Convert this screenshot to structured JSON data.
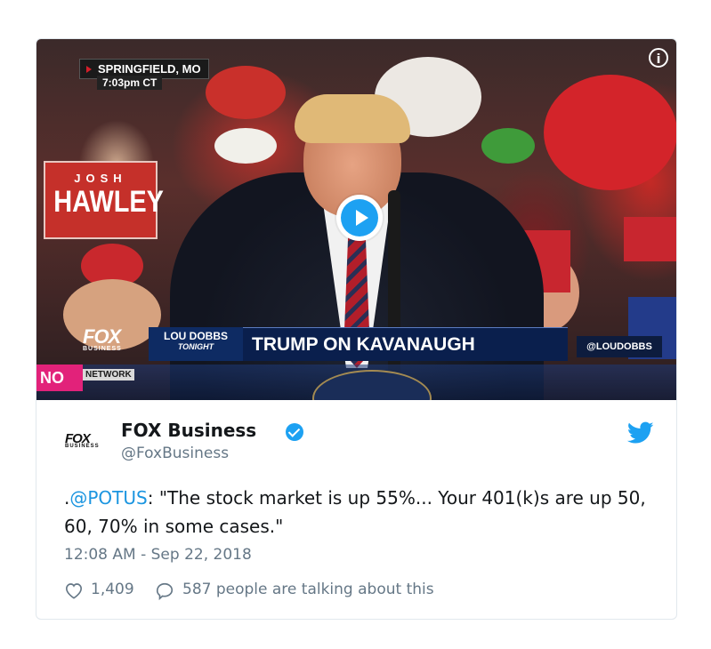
{
  "video": {
    "location": "SPRINGFIELD, MO",
    "time": "7:03pm CT",
    "sign_small": "JOSH",
    "sign_big": "HAWLEY",
    "network_logo": "FOX",
    "network_sub": "BUSINESS",
    "network_tag": "NETWORK",
    "show_name": "LOU DOBBS",
    "show_sub": "TONIGHT",
    "headline": "TRUMP ON KAVANAUGH",
    "show_handle": "@LOUDOBBS",
    "pink_sign": "NO",
    "play_icon": "play-icon",
    "info_icon": "info-icon"
  },
  "tweet": {
    "author_name": "FOX Business",
    "author_handle": "@FoxBusiness",
    "logo_text": "FOX",
    "logo_sub": "BUSINESS",
    "text_prefix": ".",
    "mention": "@POTUS",
    "text_body": ": \"The stock market is up 55%... Your 401(k)s are up 50, 60, 70% in some cases.\"",
    "timestamp": "12:08 AM - Sep 22, 2018",
    "likes": "1,409",
    "talking": "587 people are talking about this"
  },
  "colors": {
    "accent": "#1da1f2",
    "mention": "#1b95e0",
    "muted": "#657786",
    "text": "#14171a"
  }
}
